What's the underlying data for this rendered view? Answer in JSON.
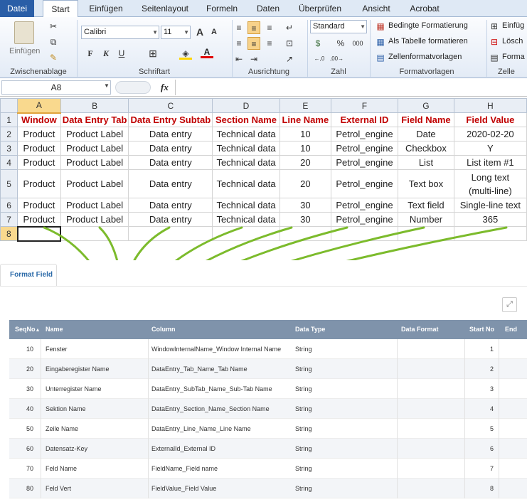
{
  "ribbon": {
    "tabs": [
      "Datei",
      "Start",
      "Einfügen",
      "Seitenlayout",
      "Formeln",
      "Daten",
      "Überprüfen",
      "Ansicht",
      "Acrobat"
    ],
    "paste_label": "Einfügen",
    "font_name": "Calibri",
    "font_size": "11",
    "number_format": "Standard",
    "bold": "F",
    "italic": "K",
    "underline": "U",
    "cond_format": "Bedingte Formatierung",
    "as_table": "Als Tabelle formatieren",
    "cell_styles": "Zellenformatvorlagen",
    "insert": "Einfüg",
    "delete": "Lösch",
    "format": "Forma",
    "groups": {
      "clipboard": "Zwischenablage",
      "font": "Schriftart",
      "alignment": "Ausrichtung",
      "number": "Zahl",
      "styles": "Formatvorlagen",
      "cells": "Zelle"
    }
  },
  "formula_bar": {
    "name_box": "A8",
    "fx": "fx",
    "content": ""
  },
  "sheet": {
    "columns": [
      "A",
      "B",
      "C",
      "D",
      "E",
      "F",
      "G",
      "H"
    ],
    "rows": [
      {
        "n": "1",
        "cells": [
          "Window",
          "Data Entry Tab",
          "Data Entry Subtab",
          "Section Name",
          "Line Name",
          "External ID",
          "Field Name",
          "Field Value"
        ]
      },
      {
        "n": "2",
        "cells": [
          "Product",
          "Product Label",
          "Data entry",
          "Technical data",
          "10",
          "Petrol_engine",
          "Date",
          "2020-02-20"
        ]
      },
      {
        "n": "3",
        "cells": [
          "Product",
          "Product Label",
          "Data entry",
          "Technical data",
          "10",
          "Petrol_engine",
          "Checkbox",
          "Y"
        ]
      },
      {
        "n": "4",
        "cells": [
          "Product",
          "Product Label",
          "Data entry",
          "Technical data",
          "20",
          "Petrol_engine",
          "List",
          "List item #1"
        ]
      },
      {
        "n": "5",
        "cells": [
          "Product",
          "Product Label",
          "Data entry",
          "Technical data",
          "20",
          "Petrol_engine",
          "Text box",
          "Long text"
        ],
        "extra": "(multi-line)"
      },
      {
        "n": "6",
        "cells": [
          "Product",
          "Product Label",
          "Data entry",
          "Technical data",
          "30",
          "Petrol_engine",
          "Text field",
          "Single-line text"
        ]
      },
      {
        "n": "7",
        "cells": [
          "Product",
          "Product Label",
          "Data entry",
          "Technical data",
          "30",
          "Petrol_engine",
          "Number",
          "365"
        ]
      },
      {
        "n": "8",
        "cells": [
          "",
          "",
          "",
          "",
          "",
          "",
          "",
          ""
        ]
      }
    ]
  },
  "panel": {
    "tab": "Format Field",
    "headers": [
      "SeqNo",
      "Name",
      "Column",
      "Data Type",
      "Data Format",
      "Start No",
      "End"
    ],
    "sort_indicator": "▲",
    "rows": [
      {
        "seq": "10",
        "name": "Fenster",
        "column": "WindowInternalName_Window Internal Name",
        "type": "String",
        "start": "1"
      },
      {
        "seq": "20",
        "name": "Eingaberegister Name",
        "column": "DataEntry_Tab_Name_Tab Name",
        "type": "String",
        "start": "2"
      },
      {
        "seq": "30",
        "name": "Unterregister Name",
        "column": "DataEntry_SubTab_Name_Sub-Tab Name",
        "type": "String",
        "start": "3"
      },
      {
        "seq": "40",
        "name": "Sektion Name",
        "column": "DataEntry_Section_Name_Section Name",
        "type": "String",
        "start": "4"
      },
      {
        "seq": "50",
        "name": "Zeile Name",
        "column": "DataEntry_Line_Name_Line Name",
        "type": "String",
        "start": "5"
      },
      {
        "seq": "60",
        "name": "Datensatz-Key",
        "column": "ExternalId_External ID",
        "type": "String",
        "start": "6"
      },
      {
        "seq": "70",
        "name": "Feld Name",
        "column": "FieldName_Field name",
        "type": "String",
        "start": "7"
      },
      {
        "seq": "80",
        "name": "Feld Vert",
        "column": "FieldValue_Field Value",
        "type": "String",
        "start": "8"
      }
    ]
  },
  "arrow_color": "#7cbb2c"
}
